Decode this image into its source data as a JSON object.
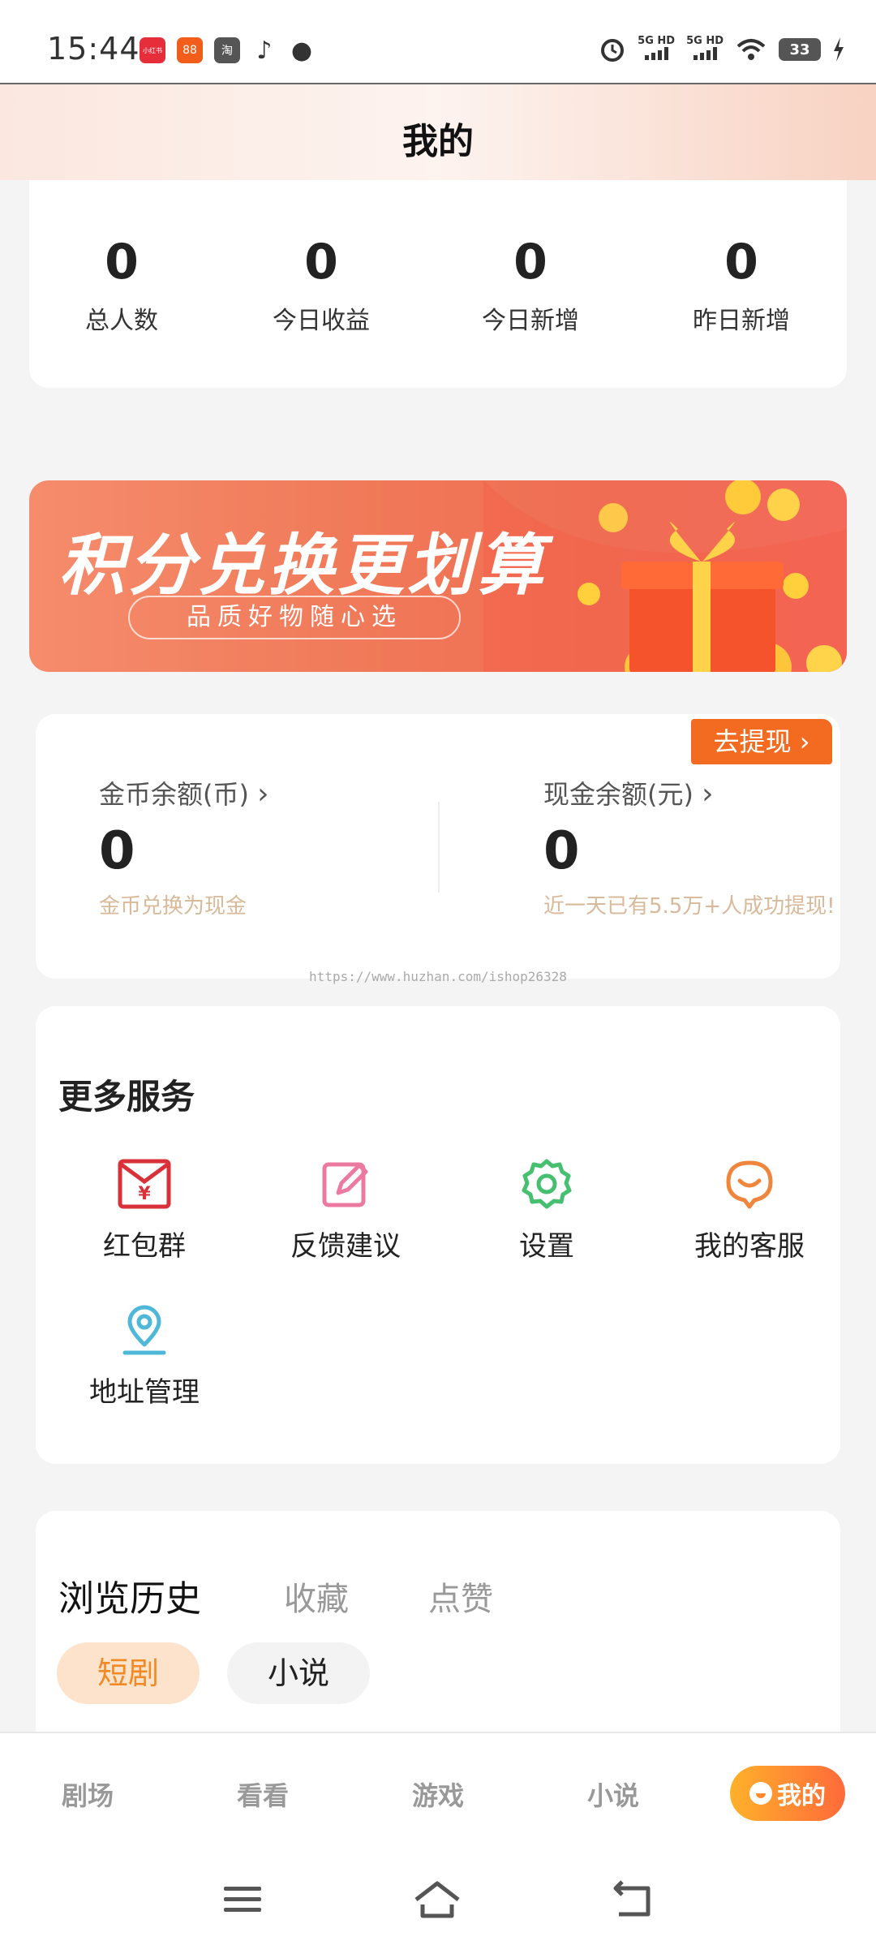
{
  "status_bar": {
    "time": "15:44",
    "apps": [
      {
        "icon": "xiaohongshu-icon",
        "color": "#e62e3b",
        "glyph": "小红书"
      },
      {
        "icon": "app-orange-icon",
        "color": "#f25d1c",
        "glyph": "88"
      },
      {
        "icon": "taobao-icon",
        "color": "#555555",
        "glyph": "淘"
      },
      {
        "icon": "tiktok-icon",
        "color": "#333333",
        "glyph": "♪"
      },
      {
        "icon": "message-icon",
        "color": "#333333",
        "glyph": "●"
      }
    ],
    "network_1": "5G HD",
    "network_2": "5G HD",
    "battery": "33"
  },
  "header": {
    "title": "我的"
  },
  "stats": [
    {
      "value": "0",
      "label": "总人数"
    },
    {
      "value": "0",
      "label": "今日收益"
    },
    {
      "value": "0",
      "label": "今日新增"
    },
    {
      "value": "0",
      "label": "昨日新增"
    }
  ],
  "banner": {
    "title": "积分兑换更划算",
    "subtitle": "品质好物随心选"
  },
  "balance": {
    "withdraw_label": "去提现",
    "coin": {
      "label": "金币余额(币)",
      "value": "0",
      "note": "金币兑换为现金"
    },
    "cash": {
      "label": "现金余额(元)",
      "value": "0",
      "note": "近一天已有5.5万+人成功提现!"
    }
  },
  "watermark": "https://www.huzhan.com/ishop26328",
  "services": {
    "title": "更多服务",
    "items": [
      {
        "label": "红包群",
        "icon": "red-envelope-icon",
        "color": "#d9313a"
      },
      {
        "label": "反馈建议",
        "icon": "feedback-edit-icon",
        "color": "#ec7aa0"
      },
      {
        "label": "设置",
        "icon": "settings-gear-icon",
        "color": "#46c070"
      },
      {
        "label": "我的客服",
        "icon": "customer-service-icon",
        "color": "#f0853c"
      },
      {
        "label": "地址管理",
        "icon": "location-pin-icon",
        "color": "#4fb8d8"
      }
    ]
  },
  "history": {
    "tabs": [
      "浏览历史",
      "收藏",
      "点赞"
    ],
    "chips": [
      "短剧",
      "小说"
    ]
  },
  "bottom_nav": {
    "items": [
      "剧场",
      "看看",
      "游戏",
      "小说"
    ],
    "active": "我的"
  },
  "colors": {
    "accent": "#f26b21",
    "chip_active_bg": "#fde3cc",
    "chip_active_text": "#f08a24"
  }
}
